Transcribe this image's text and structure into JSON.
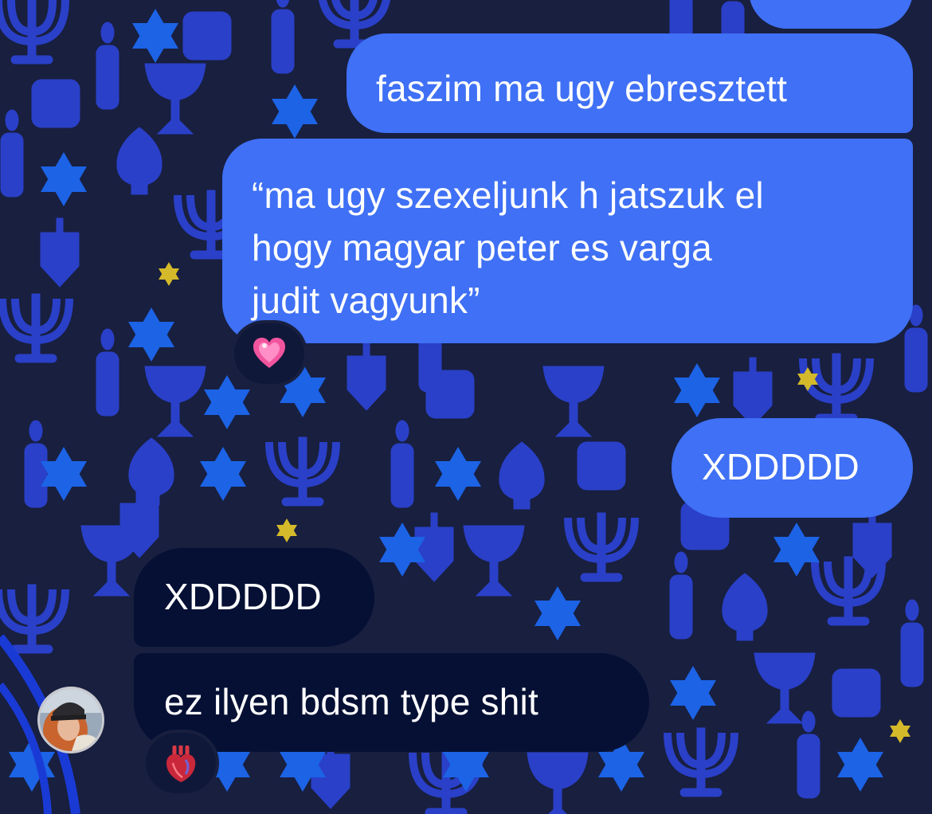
{
  "chat": {
    "background_color": "#181f3f",
    "sent_bubble_color": "#3f70f5",
    "received_bubble_color": "#051034",
    "messages": [
      {
        "from": "me",
        "text": "faszim ma ugy ebresztett"
      },
      {
        "from": "me",
        "lines": [
          "“ma ugy szexeljunk h jatszuk el",
          "hogy magyar peter es varga",
          "judit vagyunk”"
        ],
        "reaction": "heart-icon"
      },
      {
        "from": "me",
        "text": "XDDDDD"
      },
      {
        "from": "them",
        "text": "XDDDDD"
      },
      {
        "from": "them",
        "text": "ez ilyen bdsm type shit",
        "reaction": "anatomical-heart-icon"
      }
    ]
  }
}
